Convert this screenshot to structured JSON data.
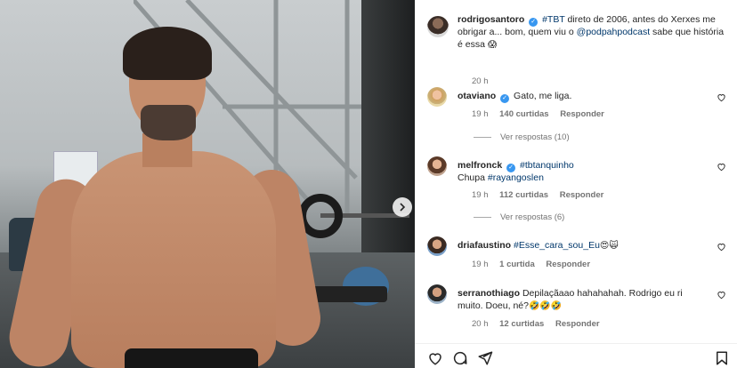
{
  "post": {
    "author": "rodrigosantoro",
    "caption_parts": {
      "hashtag": "#TBT",
      "text_a": " direto de 2006, antes do Xerxes me obrigar a... bom, quem viu o ",
      "mention": "@podpahpodcast",
      "text_b": " sabe que história é essa ",
      "emoji": "😱"
    },
    "time": "20 h"
  },
  "comments": [
    {
      "user": "otaviano",
      "verified": true,
      "text": "Gato, me liga.",
      "time": "19 h",
      "likes": "140 curtidas",
      "reply": "Responder",
      "view_replies": "Ver respostas (10)"
    },
    {
      "user": "melfronck",
      "verified": true,
      "hashtag": "#tbtanquinho",
      "text_line2_plain": "Chupa ",
      "text_line2_tag": "#rayangoslen",
      "time": "19 h",
      "likes": "112 curtidas",
      "reply": "Responder",
      "view_replies": "Ver respostas (6)"
    },
    {
      "user": "driafaustino",
      "verified": false,
      "hashtag": "#Esse_cara_sou_Eu",
      "emoji": "😍🙀",
      "time": "19 h",
      "likes": "1 curtida",
      "reply": "Responder"
    },
    {
      "user": "serranothiago",
      "verified": false,
      "text": "Depilaçãaao hahahahah. Rodrigo eu ri muito. Doeu, né?",
      "emoji": "🤣🤣🤣",
      "time": "20 h",
      "likes": "12 curtidas",
      "reply": "Responder"
    }
  ],
  "icons": {
    "heart": "heart-icon",
    "comment": "comment-icon",
    "share": "share-icon",
    "save": "bookmark-icon",
    "next": "chevron-right-icon",
    "verified": "verified-badge-icon"
  },
  "colors": {
    "verified": "#3897f0",
    "link": "#00376b",
    "muted": "#737373"
  }
}
